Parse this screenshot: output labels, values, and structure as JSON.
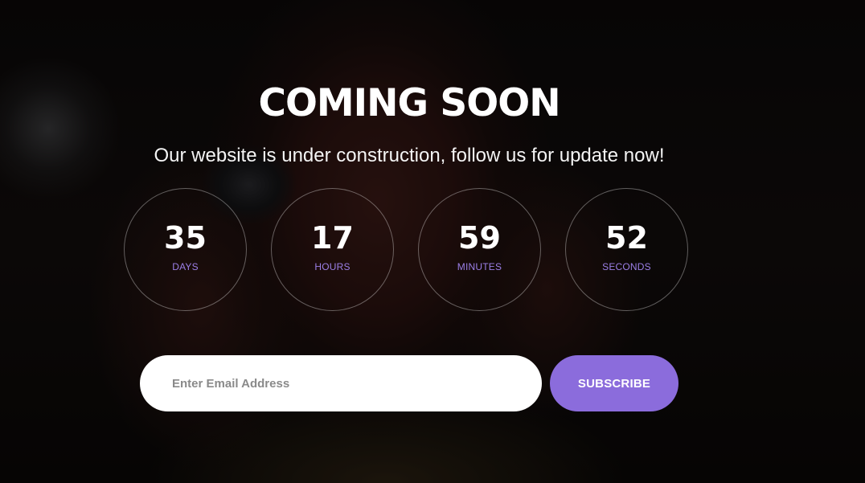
{
  "hero": {
    "title": "COMING SOON",
    "subtitle": "Our website is under construction, follow us for update now!"
  },
  "countdown": [
    {
      "value": "35",
      "unit": "DAYS"
    },
    {
      "value": "17",
      "unit": "HOURS"
    },
    {
      "value": "59",
      "unit": "MINUTES"
    },
    {
      "value": "52",
      "unit": "SECONDS"
    }
  ],
  "subscribe": {
    "placeholder": "Enter Email Address",
    "button_label": "SUBSCRIBE"
  },
  "colors": {
    "accent": "#8b6cdc",
    "unit_label": "#9b7fe6",
    "input_bg": "#ffffff"
  }
}
